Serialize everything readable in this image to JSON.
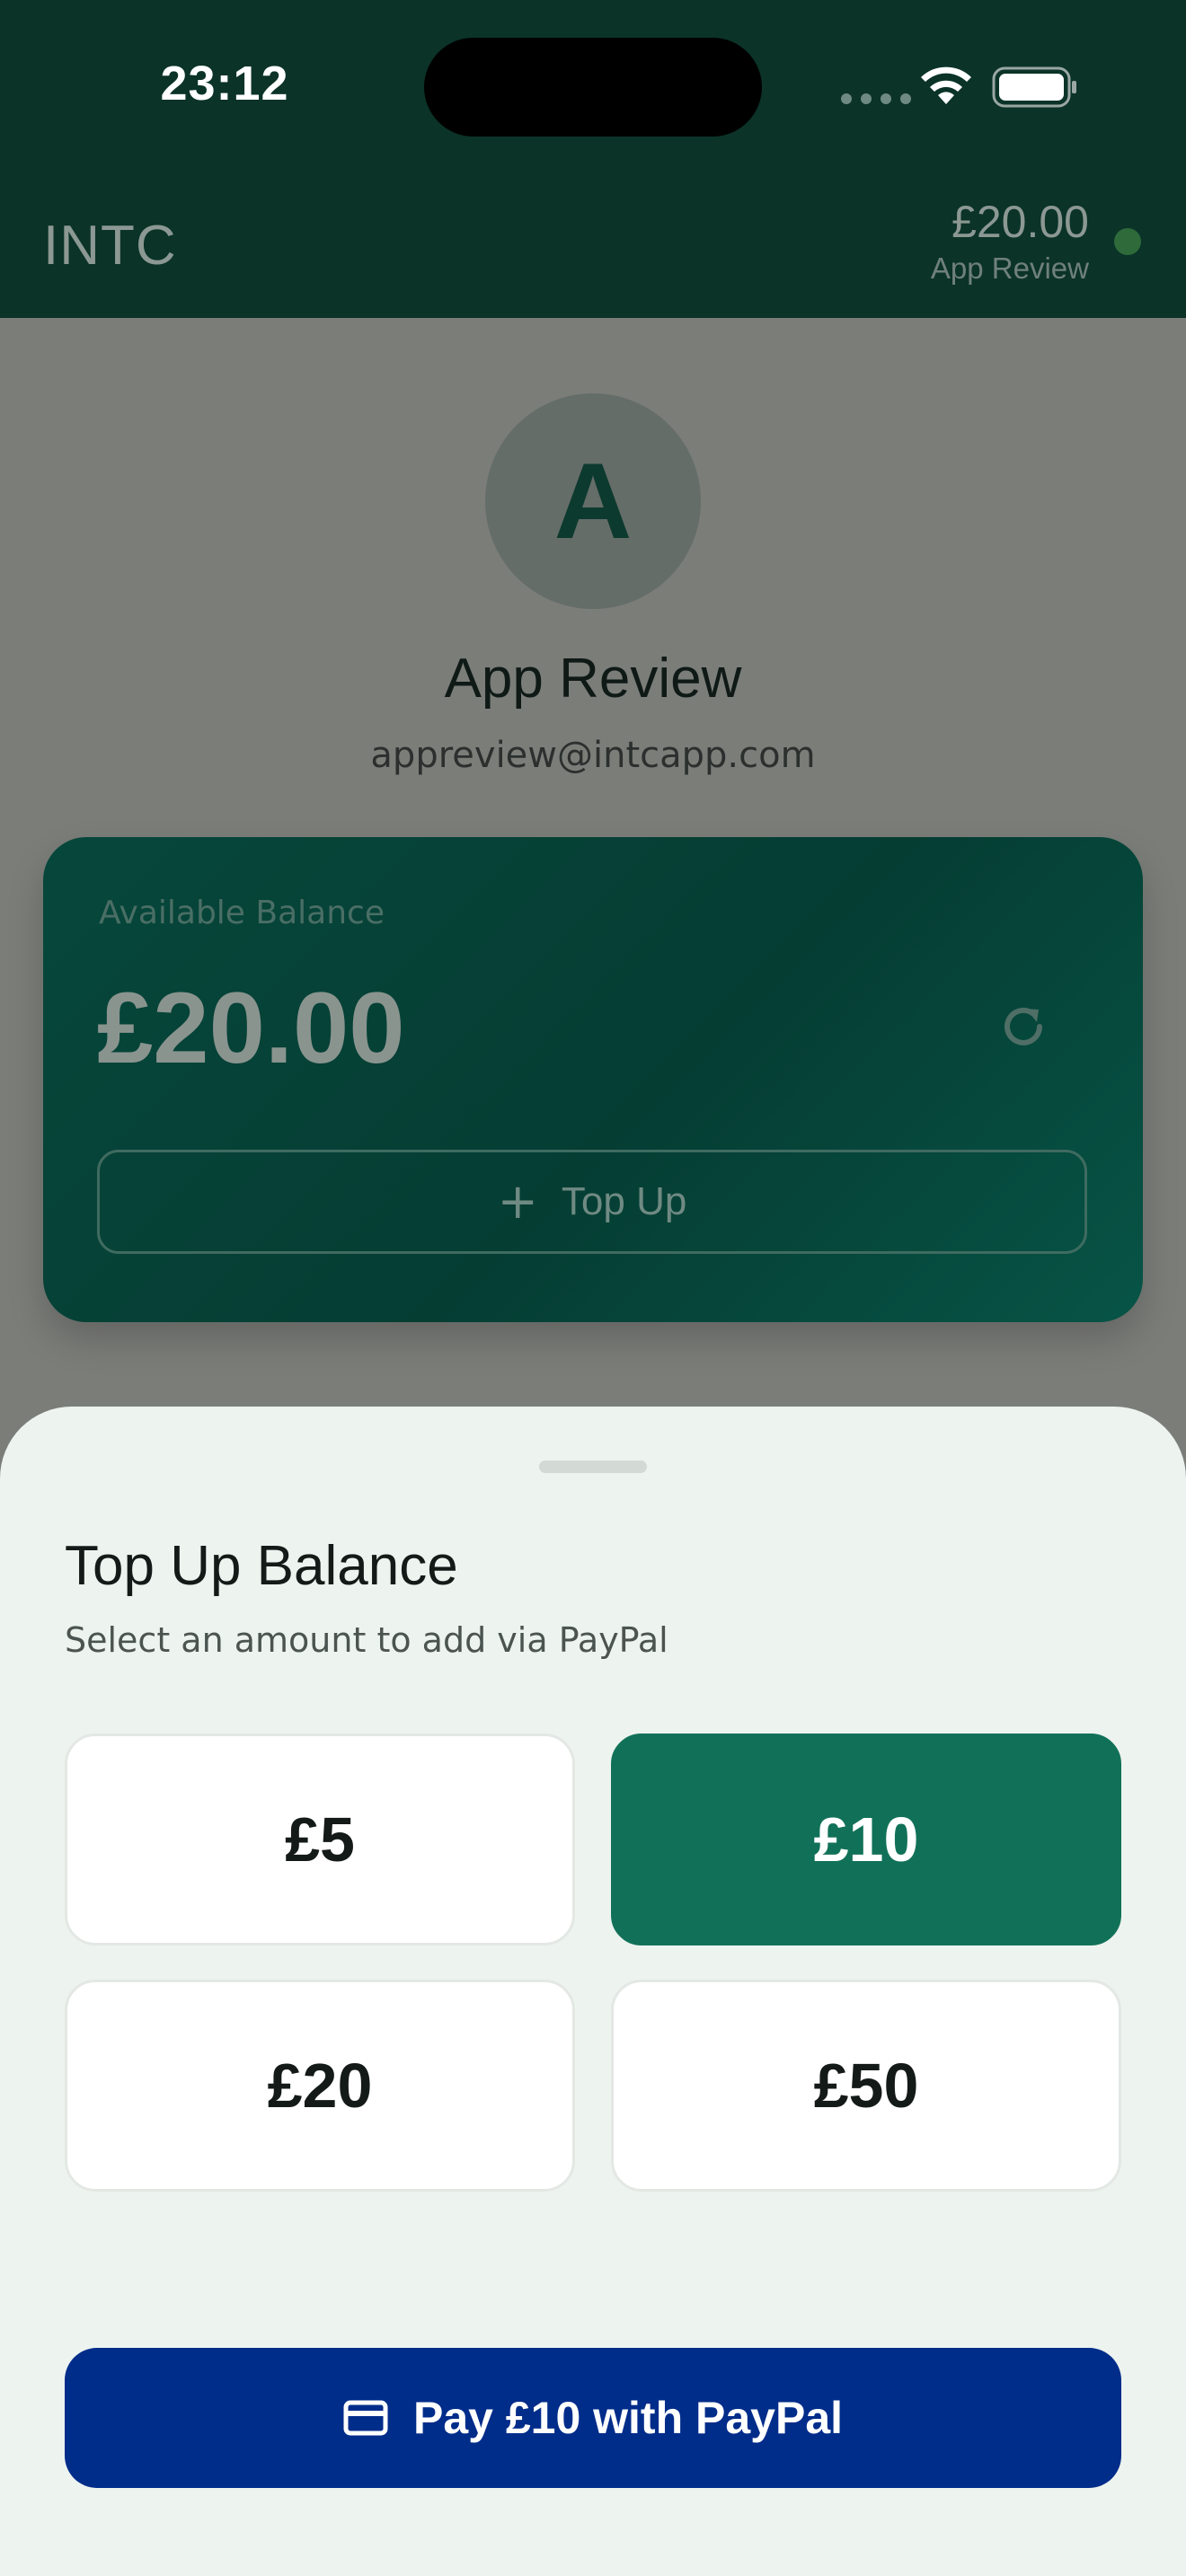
{
  "status_bar": {
    "time": "23:12",
    "icons": [
      "cellular-signal-icon",
      "wifi-icon",
      "battery-icon"
    ]
  },
  "header": {
    "brand": "INTC",
    "balance": "£20.00",
    "user_name": "App Review",
    "status": "online"
  },
  "profile": {
    "avatar_initial": "A",
    "name": "App Review",
    "email": "appreview@intcapp.com"
  },
  "balance_card": {
    "label": "Available Balance",
    "amount": "£20.00",
    "refresh_icon": "refresh-icon",
    "topup_label": "Top Up",
    "topup_icon": "plus-icon"
  },
  "sheet": {
    "title": "Top Up Balance",
    "subtitle": "Select an amount to add via PayPal",
    "amounts": [
      {
        "label": "£5",
        "selected": false
      },
      {
        "label": "£10",
        "selected": true
      },
      {
        "label": "£20",
        "selected": false
      },
      {
        "label": "£50",
        "selected": false
      }
    ],
    "pay_label": "Pay £10 with PayPal",
    "pay_icon": "credit-card-icon"
  },
  "colors": {
    "header_bg": "#0b3328",
    "card_bg": "#064a3d",
    "selected_amount": "#117158",
    "paypal_button": "#002c8a",
    "sheet_bg": "#edf3ef"
  }
}
